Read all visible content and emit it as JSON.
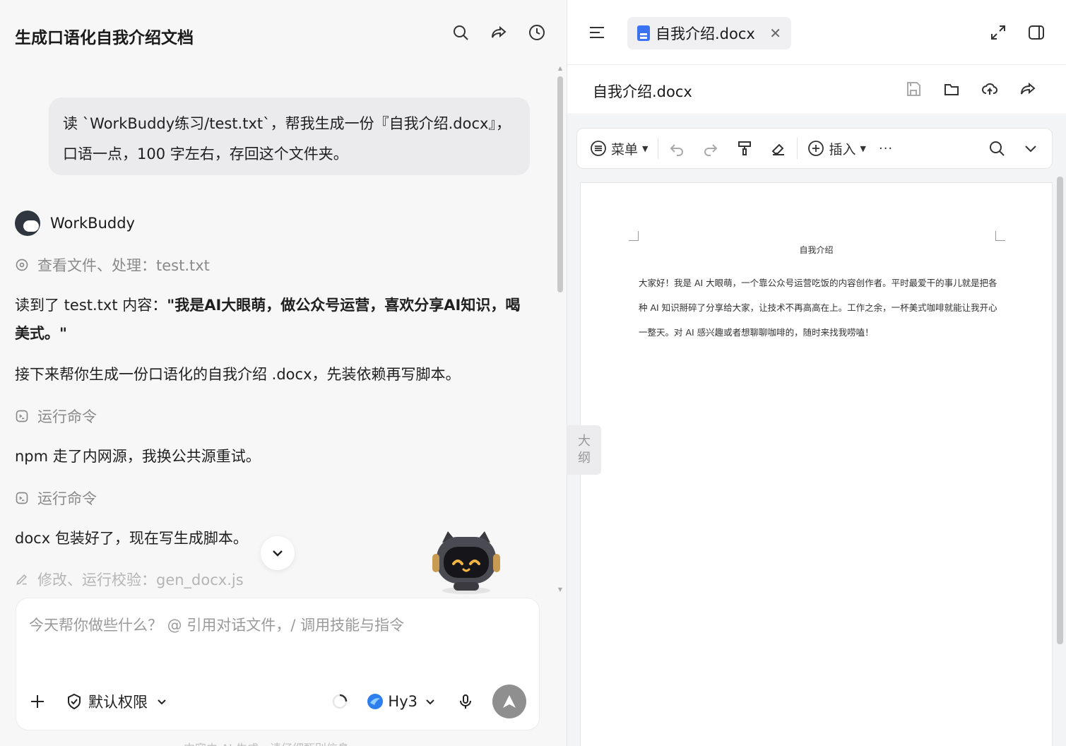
{
  "chat": {
    "title": "生成口语化自我介绍文档",
    "user_message_line1": "读 `WorkBuddy练习/test.txt`，帮我生成一份『自我介绍.docx』，",
    "user_message_line2": "口语一点，100 字左右，存回这个文件夹。",
    "bot_name": "WorkBuddy",
    "step1": "查看文件、处理：test.txt",
    "para1_prefix": "读到了 test.txt 内容：",
    "para1_bold": "\"我是AI大眼萌，做公众号运营，喜欢分享AI知识，喝美式。\"",
    "para2": "接下来帮你生成一份口语化的自我介绍 .docx，先装依赖再写脚本。",
    "step2": "运行命令",
    "para3": "npm 走了内网源，我换公共源重试。",
    "step3": "运行命令",
    "para4": "docx 包装好了，现在写生成脚本。",
    "step4": "修改、运行校验：gen_docx.js"
  },
  "input": {
    "placeholder": "今天帮你做些什么？ @ 引用对话文件，/ 调用技能与指令",
    "permission_label": "默认权限",
    "model_label": "Hy3",
    "footnote": "内容由 AI 生成，请仔细甄别信息"
  },
  "doc_panel": {
    "tab_label": "自我介绍.docx",
    "file_name": "自我介绍.docx",
    "toolbar_menu": "菜单",
    "toolbar_insert": "插入",
    "toolbar_more": "···",
    "doc_title": "自我介绍",
    "doc_body": "大家好！我是 AI 大眼萌，一个靠公众号运营吃饭的内容创作者。平时最爱干的事儿就是把各种 AI 知识掰碎了分享给大家，让技术不再高高在上。工作之余，一杯美式咖啡就能让我开心一整天。对 AI 感兴趣或者想聊聊咖啡的，随时来找我唠嗑！",
    "outline_line1": "大",
    "outline_line2": "纲"
  },
  "colors": {
    "accent": "#3b74f2",
    "send_button": "#8f8f8f"
  }
}
